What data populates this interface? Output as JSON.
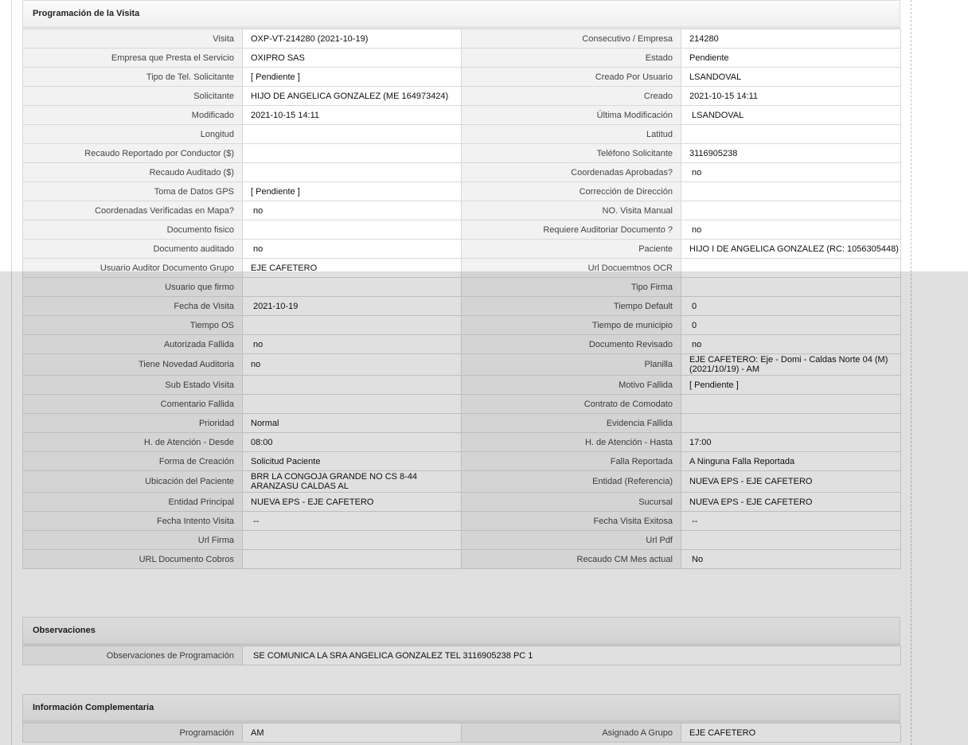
{
  "schedule": {
    "title": "Programación de la Visita",
    "rows": [
      {
        "l1": "Visita",
        "v1": "OXP-VT-214280 (2021-10-19)",
        "l2": "Consecutivo / Empresa",
        "v2": "214280"
      },
      {
        "l1": "Empresa que Presta el Servicio",
        "v1": "OXIPRO SAS",
        "l2": "Estado",
        "v2": "Pendiente"
      },
      {
        "l1": "Tipo de Tel. Solicitante",
        "v1": "[ Pendiente ]",
        "l2": "Creado Por Usuario",
        "v2": "LSANDOVAL"
      },
      {
        "l1": "Solicitante",
        "v1": "HIJO DE ANGELICA GONZALEZ (ME 164973424)",
        "l2": "Creado",
        "v2": "2021-10-15 14:11"
      },
      {
        "l1": "Modificado",
        "v1": "2021-10-15 14:11",
        "l2": "Última Modificación",
        "v2": " LSANDOVAL"
      },
      {
        "l1": "Longitud",
        "v1": "",
        "l2": "Latitud",
        "v2": ""
      },
      {
        "l1": "Recaudo Reportado por Conductor ($)",
        "v1": "",
        "l2": "Teléfono Solicitante",
        "v2": "3116905238"
      },
      {
        "l1": "Recaudo Auditado ($)",
        "v1": "",
        "l2": "Coordenadas Aprobadas?",
        "v2": " no"
      },
      {
        "l1": "Toma de Datos GPS",
        "v1": "[ Pendiente ]",
        "l2": "Corrección de Dirección",
        "v2": ""
      },
      {
        "l1": "Coordenadas Verificadas en Mapa?",
        "v1": " no",
        "l2": "NO. Visita Manual",
        "v2": ""
      },
      {
        "l1": "Documento fisico",
        "v1": "",
        "l2": "Requiere Auditoriar Documento ?",
        "v2": " no"
      },
      {
        "l1": "Documento auditado",
        "v1": " no",
        "l2": "Paciente",
        "v2": "HIJO I DE ANGELICA GONZALEZ (RC: 1056305448)"
      },
      {
        "l1": "Usuario Auditor Documento Grupo",
        "v1": "EJE CAFETERO",
        "l2": "Url Docuemtnos OCR",
        "v2": ""
      },
      {
        "l1": "Usuario que firmo",
        "v1": "",
        "l2": "Tipo Firma",
        "v2": ""
      },
      {
        "l1": "Fecha de Visita",
        "v1": " 2021-10-19",
        "l2": "Tiempo Default",
        "v2": " 0"
      },
      {
        "l1": "Tiempo OS",
        "v1": "",
        "l2": "Tiempo de municipio",
        "v2": " 0"
      },
      {
        "l1": "Autorizada Fallida",
        "v1": " no",
        "l2": "Documento Revisado",
        "v2": " no"
      },
      {
        "l1": "Tiene Novedad Auditoria",
        "v1": " no",
        "l2": "Planilla",
        "v2": "EJE CAFETERO: Eje - Domi - Caldas Norte 04 (M) (2021/10/19) - AM",
        "tall": true
      },
      {
        "l1": "Sub Estado Visita",
        "v1": "",
        "l2": "Motivo Fallida",
        "v2": "[ Pendiente ]"
      },
      {
        "l1": "Comentario Fallida",
        "v1": "",
        "l2": "Contrato de Comodato",
        "v2": ""
      },
      {
        "l1": "Prioridad",
        "v1": "Normal",
        "l2": "Evidencia Fallida",
        "v2": ""
      },
      {
        "l1": "H. de Atención - Desde",
        "v1": "08:00",
        "l2": "H. de Atención - Hasta",
        "v2": "17:00"
      },
      {
        "l1": "Forma de Creación",
        "v1": "Solicitud Paciente",
        "l2": "Falla Reportada",
        "v2": "A Ninguna Falla Reportada"
      },
      {
        "l1": "Ubicación del Paciente",
        "v1": "BRR LA CONGOJA GRANDE NO CS 8-44 ARANZASU CALDAS AL",
        "l2": "Entidad (Referencia)",
        "v2": "NUEVA EPS - EJE CAFETERO",
        "tall": true
      },
      {
        "l1": "Entidad Principal",
        "v1": "NUEVA EPS - EJE CAFETERO",
        "l2": "Sucursal",
        "v2": "NUEVA EPS - EJE CAFETERO"
      },
      {
        "l1": "Fecha Intento Visita",
        "v1": " --",
        "l2": "Fecha Visita Exitosa",
        "v2": " --"
      },
      {
        "l1": "Url Firma",
        "v1": "",
        "l2": "Url Pdf",
        "v2": ""
      },
      {
        "l1": "URL Documento Cobros",
        "v1": "",
        "l2": "Recaudo CM Mes actual",
        "v2": " No"
      }
    ]
  },
  "observations": {
    "title": "Observaciones",
    "label": "Observaciones de Programación",
    "value": " SE COMUNICA LA SRA ANGELICA GONZALEZ TEL 3116905238 PC 1"
  },
  "complementary": {
    "title": "Información Complementaria",
    "rows": [
      {
        "l1": "Programación",
        "v1": "AM",
        "l2": "Asignado A Grupo",
        "v2": "EJE CAFETERO"
      }
    ]
  }
}
